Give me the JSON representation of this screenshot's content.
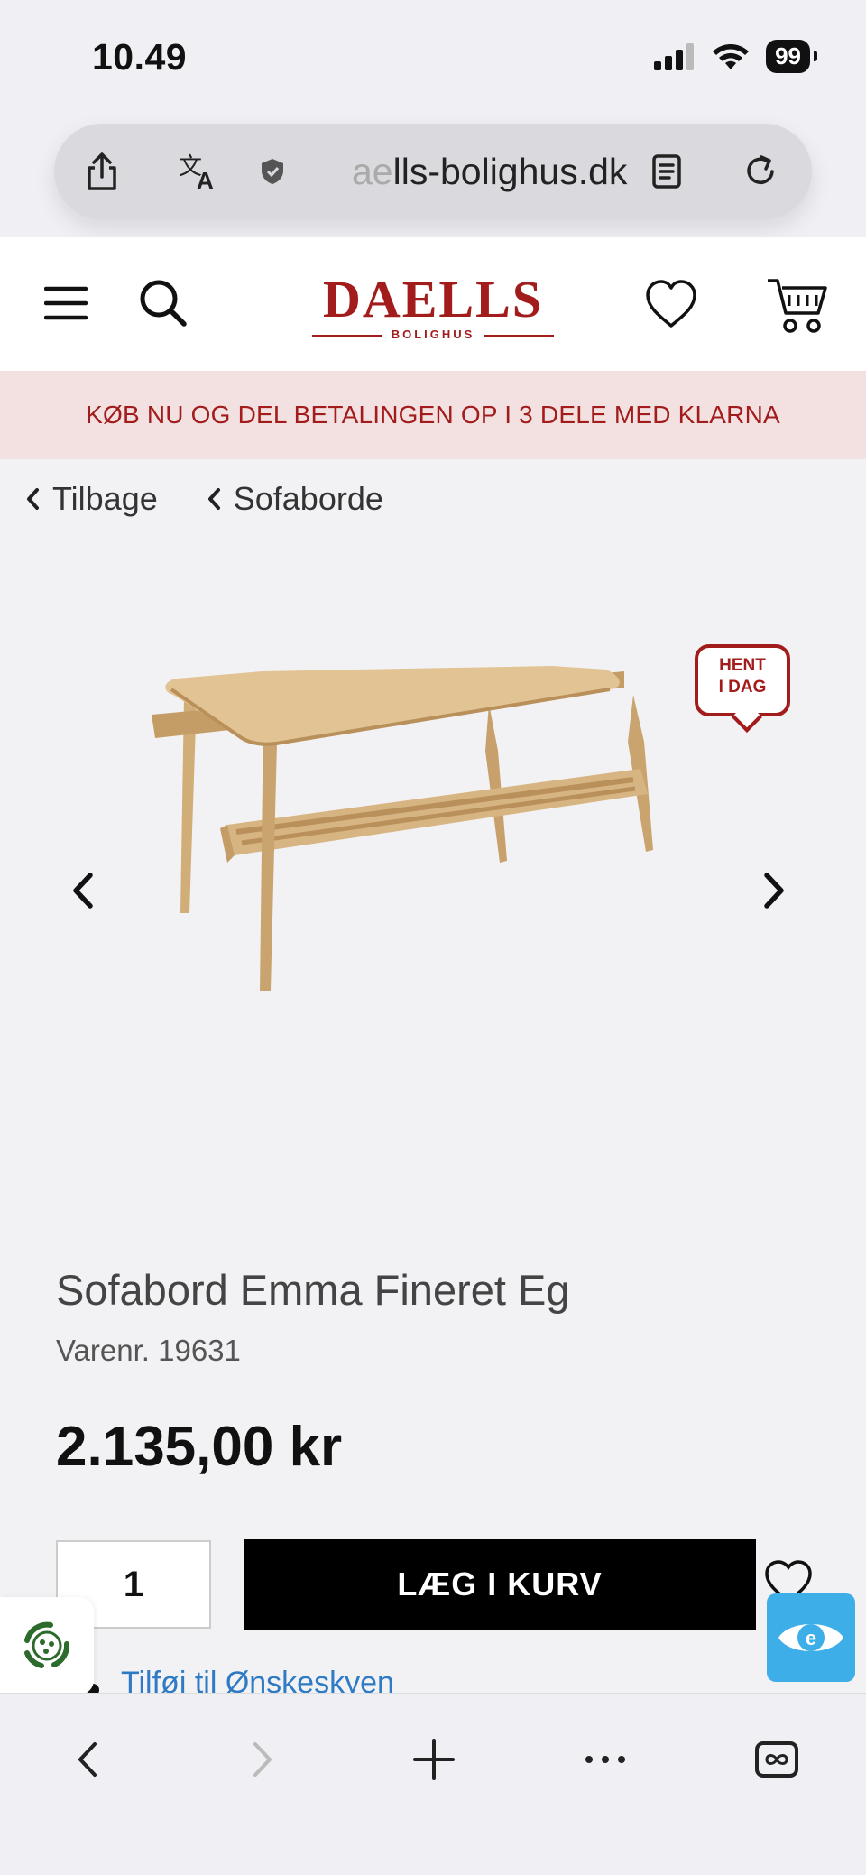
{
  "status_bar": {
    "time": "10.49",
    "battery": "99"
  },
  "browser": {
    "url_host_faded": "ae",
    "url_host": "lls-bolighus.dk"
  },
  "header": {
    "logo_main": "DAELLS",
    "logo_sub": "BOLIGHUS"
  },
  "promo": {
    "text": "KØB NU OG DEL BETALINGEN OP I 3 DELE MED KLARNA"
  },
  "breadcrumbs": [
    {
      "label": "Tilbage"
    },
    {
      "label": "Sofaborde"
    }
  ],
  "gallery": {
    "badge_line1": "HENT",
    "badge_line2": "I DAG"
  },
  "product": {
    "title": "Sofabord Emma Fineret Eg",
    "sku": "Varenr. 19631",
    "price": "2.135,00 kr",
    "quantity": "1",
    "add_to_cart": "LÆG I KURV",
    "wishlist_link": "Tilføj til Ønskeskyen"
  },
  "colors": {
    "brand": "#a31c1c",
    "accent_blue": "#3daee8",
    "link": "#2f7ac4"
  }
}
